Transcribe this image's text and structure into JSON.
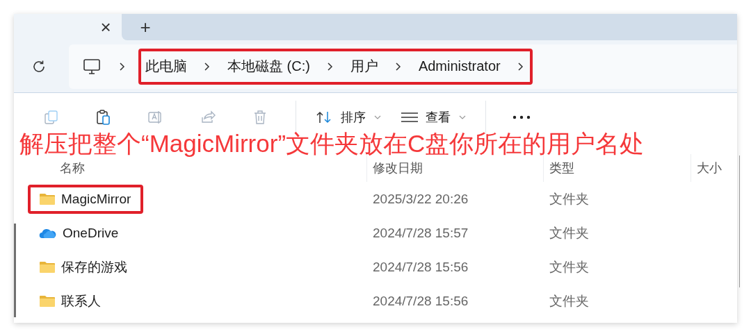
{
  "tabs": {
    "close": "×",
    "new": "+"
  },
  "breadcrumb": {
    "highlighted": true,
    "items": [
      "此电脑",
      "本地磁盘 (C:)",
      "用户",
      "Administrator"
    ]
  },
  "toolbar": {
    "icon_buttons": [
      {
        "kind": "copy",
        "disabled": true
      },
      {
        "kind": "paste",
        "disabled": false
      },
      {
        "kind": "rename",
        "disabled": true
      },
      {
        "kind": "share",
        "disabled": true
      },
      {
        "kind": "delete",
        "disabled": true
      }
    ],
    "sort": "排序",
    "view": "查看"
  },
  "annotation": "解压把整个“MagicMirror”文件夹放在C盘你所在的用户名处",
  "table": {
    "columns": [
      "名称",
      "修改日期",
      "类型",
      "大小"
    ],
    "rows": [
      {
        "kind": "folder",
        "name": "MagicMirror",
        "date": "2025/3/22 20:26",
        "type": "文件夹",
        "highlighted": true
      },
      {
        "kind": "cloud",
        "name": "OneDrive",
        "date": "2024/7/28 15:57",
        "type": "文件夹",
        "highlighted": false
      },
      {
        "kind": "folder",
        "name": "保存的游戏",
        "date": "2024/7/28 15:56",
        "type": "文件夹",
        "highlighted": false
      },
      {
        "kind": "folder",
        "name": "联系人",
        "date": "2024/7/28 15:56",
        "type": "文件夹",
        "highlighted": false
      }
    ]
  }
}
